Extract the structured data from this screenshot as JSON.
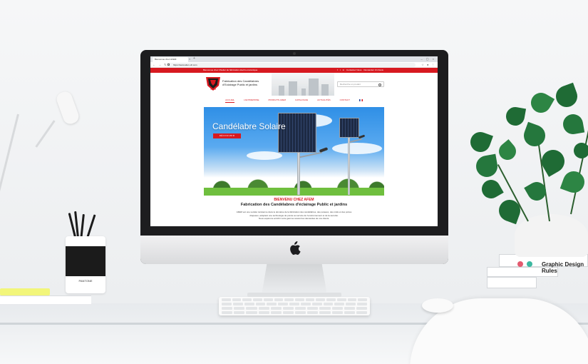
{
  "browser": {
    "tab_title": "Bienvenue chez AFEM",
    "url": "https://www.afem-dz.com"
  },
  "site": {
    "top_strip_text": "Bienvenue chez l'Atelier de fabrication électro-mécanique",
    "top_strip_links": [
      "Contactez Nous",
      "Demandez Un Devis"
    ],
    "tagline_line1": "Fabrication des Candélabres",
    "tagline_line2": "d'Eclairage Public et jardins",
    "search_placeholder": "Recherche un produit",
    "menu": [
      "ACCUEIL",
      "L'ENTREPRISE",
      "PRODUITS AFEM",
      "CATALOGUE",
      "ACTUALITÉS",
      "CONTACT"
    ],
    "hero_title": "Candélabre Solaire",
    "hero_button": "DÉCOUVRIR",
    "welcome": "BIENVENU CHEZ AFEM",
    "subtitle": "Fabrication des Candélabres d'éclairage Public et jardins",
    "intro_1": "AFEM est une société tunisienne dans le domaine de la fabrication des candélabres, des poteaux, des mâts et des portes",
    "intro_2": "drapeaux, adoptant une technologie de pointe au service de l'environnement et de la sécurité.",
    "intro_3": "Nous espérons enrichir notre gamme suivant les demandes de nos clients."
  },
  "scene": {
    "cup_brand": "PANTONE",
    "book_title": "Graphic Design Rules"
  },
  "colors": {
    "brand_red": "#d71920",
    "sky": "#2f8fe6"
  }
}
